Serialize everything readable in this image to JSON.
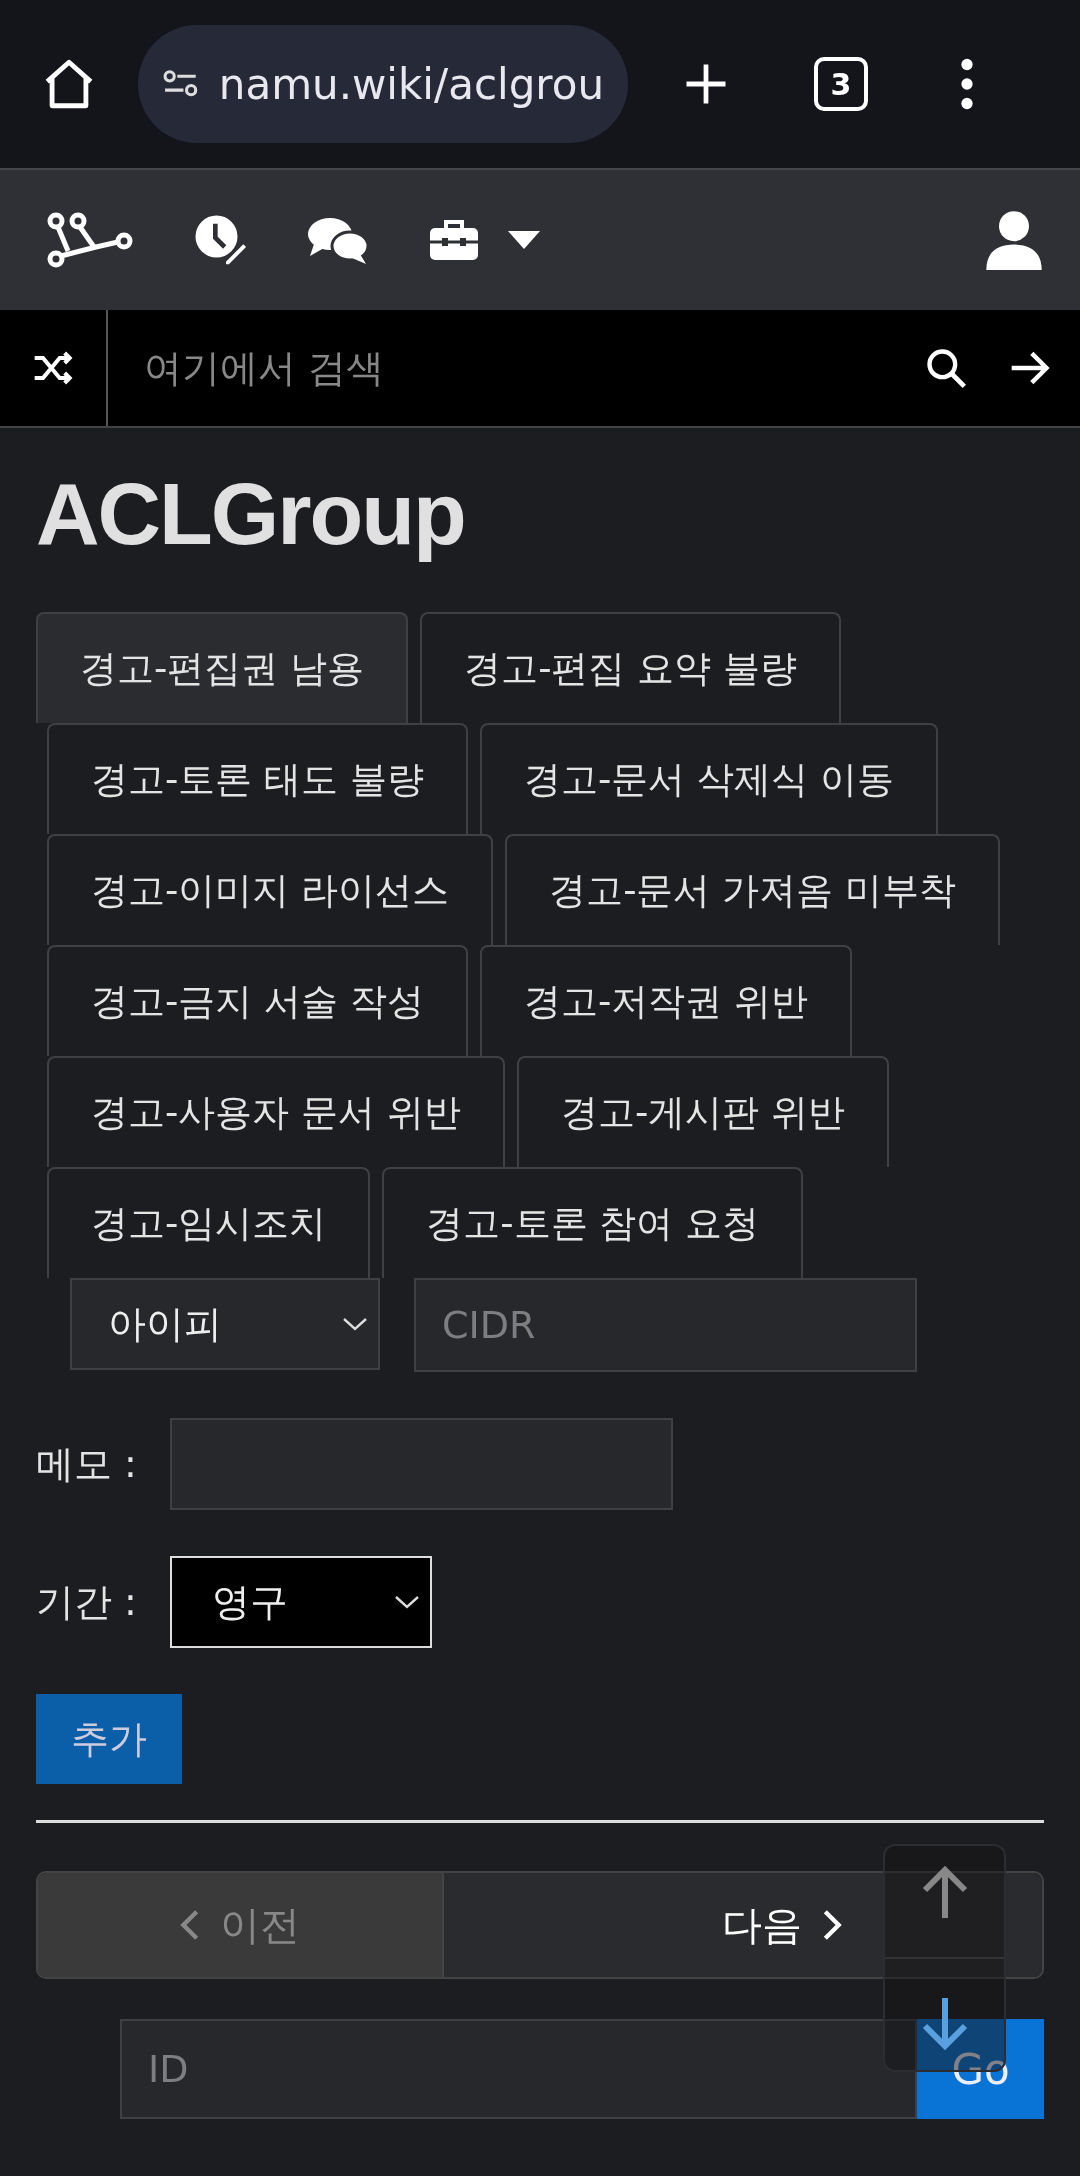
{
  "browser": {
    "url": "namu.wiki/aclgrou",
    "tab_count": "3"
  },
  "search": {
    "placeholder": "여기에서 검색"
  },
  "title": "ACLGroup",
  "tabs": [
    {
      "label": "경고-편집권 남용",
      "selected": true
    },
    {
      "label": "경고-편집 요약 불량",
      "selected": false
    },
    {
      "label": "경고-토론 태도 불량",
      "selected": false
    },
    {
      "label": "경고-문서 삭제식 이동",
      "selected": false
    },
    {
      "label": "경고-이미지 라이선스",
      "selected": false
    },
    {
      "label": "경고-문서 가져옴 미부착",
      "selected": false
    },
    {
      "label": "경고-금지 서술 작성",
      "selected": false
    },
    {
      "label": "경고-저작권 위반",
      "selected": false
    },
    {
      "label": "경고-사용자 문서 위반",
      "selected": false
    },
    {
      "label": "경고-게시판 위반",
      "selected": false
    },
    {
      "label": "경고-임시조치",
      "selected": false
    },
    {
      "label": "경고-토론 참여 요청",
      "selected": false
    }
  ],
  "form": {
    "type_select": "아이피",
    "cidr": {
      "placeholder": "CIDR"
    },
    "memo_label": "메모 :",
    "duration_label": "기간 :",
    "duration_select": "영구",
    "add_button": "추가"
  },
  "pagination": {
    "prev": {
      "label": "이전",
      "disabled": true
    },
    "next": {
      "label": "다음",
      "disabled": false
    }
  },
  "goto": {
    "placeholder": "ID",
    "button": "Go"
  }
}
